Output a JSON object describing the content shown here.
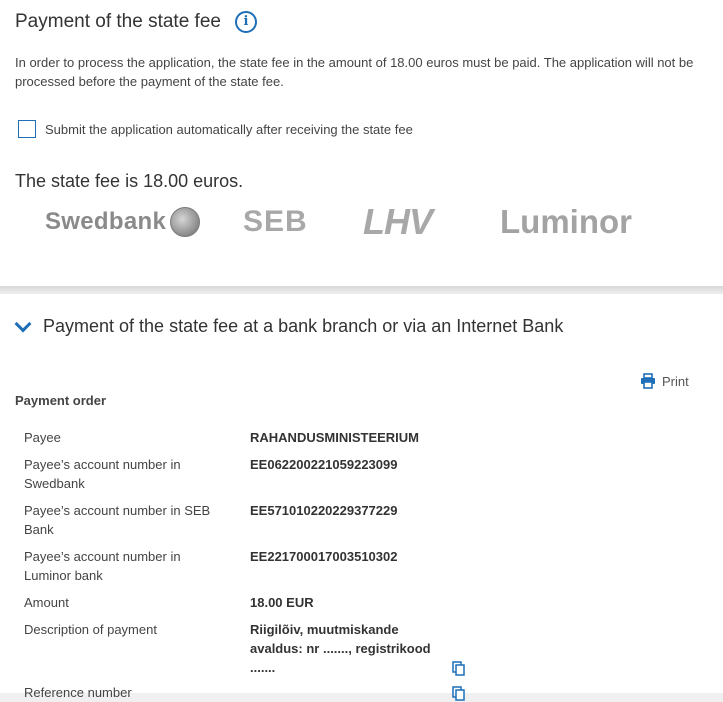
{
  "fee_section": {
    "title": "Payment of the state fee",
    "intro": "In order to process the application, the state fee in the amount of 18.00 euros must be paid. The application will not be processed before the payment of the state fee.",
    "auto_submit_label": "Submit the application automatically after receiving the state fee",
    "fee_line": "The state fee is 18.00 euros.",
    "banks": [
      "Swedbank",
      "SEB",
      "LHV",
      "Luminor"
    ]
  },
  "branch_section": {
    "title": "Payment of the state fee at a bank branch or via an Internet Bank",
    "print_label": "Print",
    "payment_order_label": "Payment order",
    "rows": [
      {
        "key": "Payee",
        "value": "RAHANDUSMINISTEERIUM"
      },
      {
        "key": "Payee’s account number in Swedbank",
        "value": "EE062200221059223099"
      },
      {
        "key": "Payee’s account number in SEB Bank",
        "value": "EE571010220229377229"
      },
      {
        "key": "Payee’s account number in Luminor bank",
        "value": "EE221700017003510302"
      },
      {
        "key": "Amount",
        "value": "18.00 EUR"
      },
      {
        "key": "Description of payment",
        "value": "Riigilõiv, muutmiskande avaldus: nr ......., registrikood ......."
      },
      {
        "key": "Reference number",
        "value": ""
      }
    ]
  },
  "colors": {
    "accent": "#1e6fb8",
    "logo_gray": "#a8a8a8"
  }
}
